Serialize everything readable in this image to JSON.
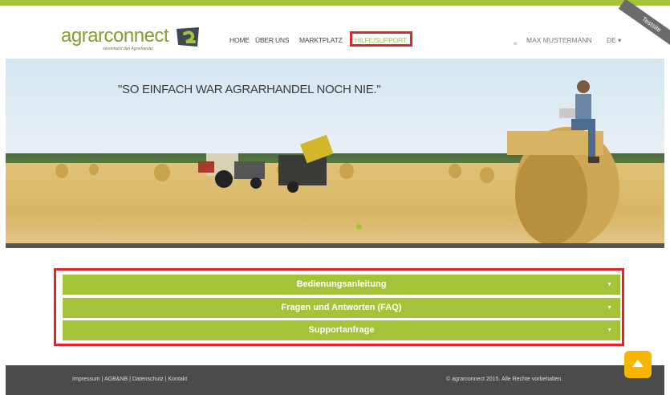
{
  "header": {
    "logo": {
      "agrar": "agrar",
      "connect": "connect",
      "tagline": "vereinfacht den Agrarhandel"
    },
    "nav": [
      {
        "label": "HOME"
      },
      {
        "label": "ÜBER UNS"
      },
      {
        "label": "MARKTPLATZ"
      },
      {
        "label": "HILFE/SUPPORT"
      }
    ],
    "user": "MAX MUSTERMANN",
    "user_tag": "AI",
    "language": "DE ▾",
    "test_ribbon": "Testsite"
  },
  "hero": {
    "quote": "\"SO EINFACH WAR AGRARHANDEL NOCH NIE.\""
  },
  "accordion": [
    {
      "label": "Bedienungsanleitung"
    },
    {
      "label": "Fragen und Antworten (FAQ)"
    },
    {
      "label": "Supportanfrage"
    }
  ],
  "footer": {
    "links": [
      "Impressum",
      "AGB&NB",
      "Datenschutz",
      "Kontakt"
    ],
    "separator": " | ",
    "copyright": "© agrarconnect 2015. Alle Rechte vorbehalten."
  },
  "colors": {
    "brand_green": "#a5c338",
    "highlight_red": "#e3242b",
    "footer_bg": "#4b4b4b",
    "scroll_button": "#f7b500"
  }
}
